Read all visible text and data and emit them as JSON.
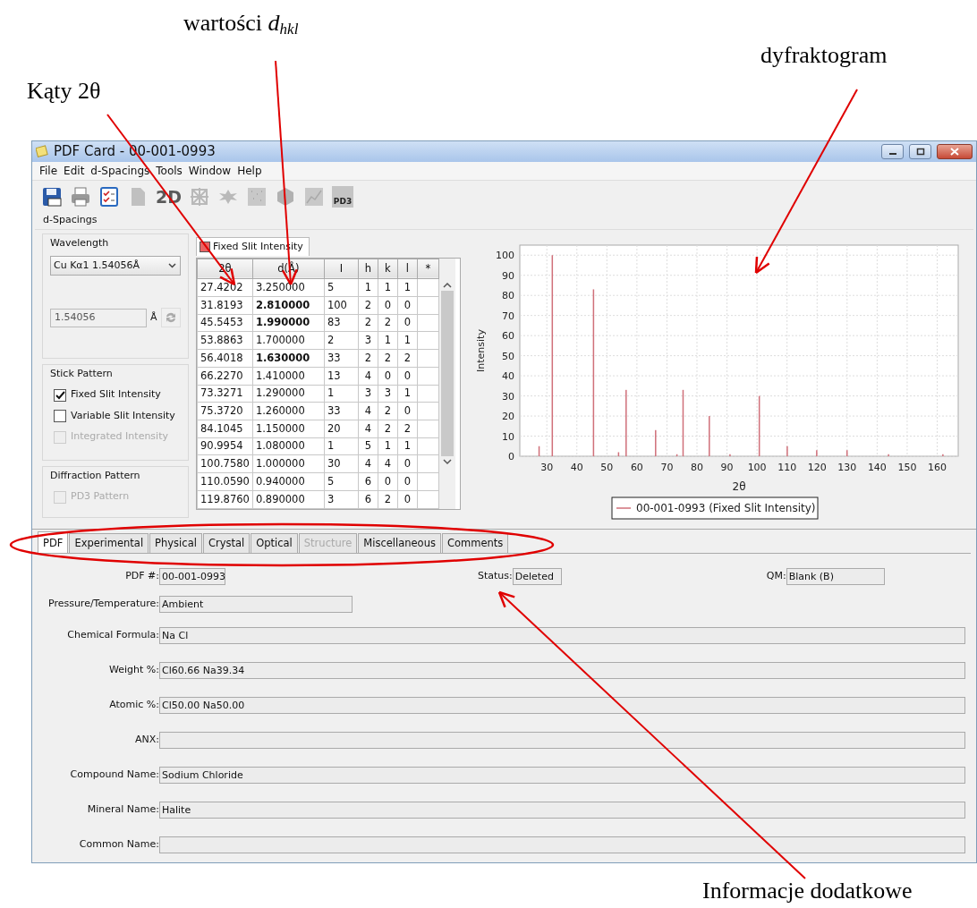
{
  "annotations": [
    {
      "text": "wartości *d*$_{hkl}$"
    },
    {
      "text": "dyfraktogram"
    },
    {
      "text": "Kąty 2θ"
    },
    {
      "text": "Informacje dodatkowe"
    }
  ],
  "window": {
    "title": "PDF Card - 00-001-0993"
  },
  "menu": [
    "File",
    "Edit",
    "d-Spacings",
    "Tools",
    "Window",
    "Help"
  ],
  "toolbar": [
    {
      "kind": "save",
      "disabled": false
    },
    {
      "kind": "print",
      "disabled": false
    },
    {
      "kind": "checklist",
      "disabled": false
    },
    {
      "kind": "document",
      "disabled": true
    },
    {
      "kind": "text",
      "text": "2D",
      "disabled": true
    },
    {
      "kind": "network",
      "disabled": true
    },
    {
      "kind": "star",
      "disabled": true
    },
    {
      "kind": "grid",
      "disabled": true
    },
    {
      "kind": "cube",
      "disabled": true
    },
    {
      "kind": "graph",
      "disabled": true
    },
    {
      "kind": "pd3",
      "text": "PD3",
      "disabled": true
    }
  ],
  "section_title": "d-Spacings",
  "wavelength": {
    "title": "Wavelength",
    "selected_option": "Cu Kα1 1.54056Å",
    "value": "1.54056",
    "unit": "Å",
    "disabled": true
  },
  "stick_pattern": {
    "title": "Stick Pattern",
    "options": [
      {
        "label": "Fixed Slit Intensity",
        "checked": true,
        "disabled": false
      },
      {
        "label": "Variable Slit Intensity",
        "checked": false,
        "disabled": false
      },
      {
        "label": "Integrated Intensity",
        "checked": false,
        "disabled": true
      }
    ]
  },
  "diffraction_pattern": {
    "title": "Diffraction Pattern",
    "options": [
      {
        "label": "PD3 Pattern",
        "checked": false,
        "disabled": true
      }
    ]
  },
  "table_tab": {
    "label": "Fixed Slit Intensity",
    "color": "#e86464"
  },
  "table": {
    "columns": [
      "2θ",
      "d(Å)",
      "I",
      "h",
      "k",
      "l",
      "*"
    ],
    "rows": [
      {
        "cells": [
          "27.4202",
          "3.250000",
          "5",
          "1",
          "1",
          "1",
          ""
        ],
        "strong": false
      },
      {
        "cells": [
          "31.8193",
          "2.810000",
          "100",
          "2",
          "0",
          "0",
          ""
        ],
        "strong": true
      },
      {
        "cells": [
          "45.5453",
          "1.990000",
          "83",
          "2",
          "2",
          "0",
          ""
        ],
        "strong": true
      },
      {
        "cells": [
          "53.8863",
          "1.700000",
          "2",
          "3",
          "1",
          "1",
          ""
        ],
        "strong": false
      },
      {
        "cells": [
          "56.4018",
          "1.630000",
          "33",
          "2",
          "2",
          "2",
          ""
        ],
        "strong": true
      },
      {
        "cells": [
          "66.2270",
          "1.410000",
          "13",
          "4",
          "0",
          "0",
          ""
        ],
        "strong": false
      },
      {
        "cells": [
          "73.3271",
          "1.290000",
          "1",
          "3",
          "3",
          "1",
          ""
        ],
        "strong": false
      },
      {
        "cells": [
          "75.3720",
          "1.260000",
          "33",
          "4",
          "2",
          "0",
          ""
        ],
        "strong": false
      },
      {
        "cells": [
          "84.1045",
          "1.150000",
          "20",
          "4",
          "2",
          "2",
          ""
        ],
        "strong": false
      },
      {
        "cells": [
          "90.9954",
          "1.080000",
          "1",
          "5",
          "1",
          "1",
          ""
        ],
        "strong": false
      },
      {
        "cells": [
          "100.7580",
          "1.000000",
          "30",
          "4",
          "4",
          "0",
          ""
        ],
        "strong": false
      },
      {
        "cells": [
          "110.0590",
          "0.940000",
          "5",
          "6",
          "0",
          "0",
          ""
        ],
        "strong": false
      },
      {
        "cells": [
          "119.8760",
          "0.890000",
          "3",
          "6",
          "2",
          "0",
          ""
        ],
        "strong": false
      }
    ]
  },
  "chart": {
    "chart_data": {
      "type": "bar",
      "xlabel": "2θ",
      "ylabel": "Intensity",
      "x": [
        27.4202,
        31.8193,
        45.5453,
        53.8863,
        56.4018,
        66.227,
        73.3271,
        75.372,
        84.1045,
        90.9954,
        100.758,
        110.059,
        119.876,
        129.974,
        143.8,
        161.9
      ],
      "series": [
        {
          "name": "00-001-0993 (Fixed Slit Intensity)",
          "color": "#d0707a",
          "values": [
            5,
            100,
            83,
            2,
            33,
            13,
            1,
            33,
            20,
            1,
            30,
            5,
            3,
            3,
            1,
            1
          ]
        }
      ],
      "xlim": [
        21,
        167
      ],
      "ylim": [
        0,
        105
      ],
      "xticks": [
        30,
        40,
        50,
        60,
        70,
        80,
        90,
        100,
        110,
        120,
        130,
        140,
        150,
        160
      ],
      "yticks": [
        0,
        10,
        20,
        30,
        40,
        50,
        60,
        70,
        80,
        90,
        100
      ],
      "grid": true
    }
  },
  "tabs": [
    {
      "label": "PDF",
      "selected": true,
      "disabled": false
    },
    {
      "label": "Experimental",
      "selected": false,
      "disabled": false
    },
    {
      "label": "Physical",
      "selected": false,
      "disabled": false
    },
    {
      "label": "Crystal",
      "selected": false,
      "disabled": false
    },
    {
      "label": "Optical",
      "selected": false,
      "disabled": false
    },
    {
      "label": "Structure",
      "selected": false,
      "disabled": true
    },
    {
      "label": "Miscellaneous",
      "selected": false,
      "disabled": false
    },
    {
      "label": "Comments",
      "selected": false,
      "disabled": false
    }
  ],
  "form": [
    {
      "fields": [
        {
          "label": "PDF #:",
          "value": "00-001-0993",
          "kind": "pdf"
        },
        {
          "label": "Status:",
          "value": "Deleted",
          "kind": "status"
        },
        {
          "label": "QM:",
          "value": "Blank (B)",
          "kind": "qm"
        }
      ]
    },
    {
      "fields": [
        {
          "label": "Pressure/Temperature:",
          "value": "Ambient",
          "kind": "medium"
        }
      ]
    },
    {
      "fields": [
        {
          "label": "Chemical Formula:",
          "value": "Na Cl",
          "kind": "full"
        }
      ]
    },
    {
      "fields": [
        {
          "label": "Weight %:",
          "value": "Cl60.66 Na39.34",
          "kind": "full"
        }
      ]
    },
    {
      "fields": [
        {
          "label": "Atomic %:",
          "value": "Cl50.00 Na50.00",
          "kind": "full"
        }
      ]
    },
    {
      "fields": [
        {
          "label": "ANX:",
          "kind": "full"
        }
      ]
    },
    {
      "fields": [
        {
          "label": "Compound Name:",
          "value": "Sodium Chloride",
          "kind": "full"
        }
      ]
    },
    {
      "fields": [
        {
          "label": "Mineral Name:",
          "value": "Halite",
          "kind": "full"
        }
      ]
    },
    {
      "fields": [
        {
          "label": "Common Name:",
          "kind": "full"
        }
      ]
    }
  ]
}
